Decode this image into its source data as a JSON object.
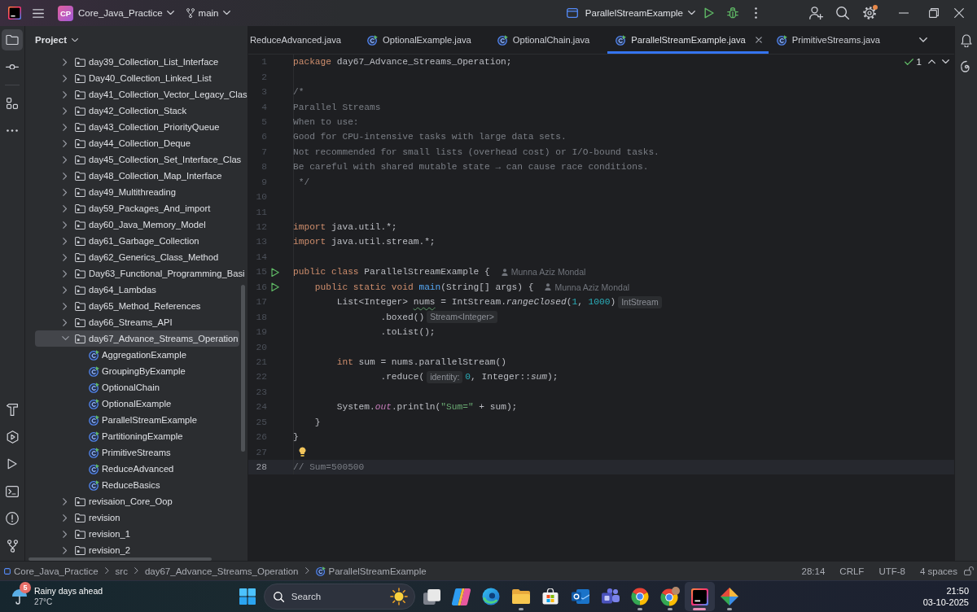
{
  "title_bar": {
    "project_badge": "CP",
    "project": "Core_Java_Practice",
    "branch": "main",
    "run_configuration": "ParallelStreamExample",
    "settings_notice": true
  },
  "tool_strip": {
    "top": [
      {
        "kind": "project",
        "selected": true
      },
      {
        "kind": "commit",
        "selected": false
      },
      {
        "kind": "structure",
        "selected": false
      },
      {
        "kind": "more",
        "selected": false
      }
    ],
    "bottom": [
      {
        "kind": "build",
        "selected": false
      },
      {
        "kind": "services",
        "selected": false
      },
      {
        "kind": "run",
        "selected": false
      },
      {
        "kind": "terminal",
        "selected": false
      },
      {
        "kind": "problems",
        "selected": false
      },
      {
        "kind": "git",
        "selected": false
      }
    ]
  },
  "project_panel": {
    "title": "Project",
    "items": [
      {
        "kind": "package",
        "label": "day39_Collection_List_Interface",
        "expanded": false,
        "selected": false
      },
      {
        "kind": "package",
        "label": "Day40_Collection_Linked_List",
        "expanded": false,
        "selected": false
      },
      {
        "kind": "package",
        "label": "day41_Collection_Vector_Legacy_Clas",
        "expanded": false,
        "selected": false
      },
      {
        "kind": "package",
        "label": "day42_Collection_Stack",
        "expanded": false,
        "selected": false
      },
      {
        "kind": "package",
        "label": "day43_Collection_PriorityQueue",
        "expanded": false,
        "selected": false
      },
      {
        "kind": "package",
        "label": "day44_Collection_Deque",
        "expanded": false,
        "selected": false
      },
      {
        "kind": "package",
        "label": "day45_Collection_Set_Interface_Clas",
        "expanded": false,
        "selected": false
      },
      {
        "kind": "package",
        "label": "day48_Collection_Map_Interface",
        "expanded": false,
        "selected": false
      },
      {
        "kind": "package",
        "label": "day49_Multithreading",
        "expanded": false,
        "selected": false
      },
      {
        "kind": "package",
        "label": "day59_Packages_And_import",
        "expanded": false,
        "selected": false
      },
      {
        "kind": "package",
        "label": "day60_Java_Memory_Model",
        "expanded": false,
        "selected": false
      },
      {
        "kind": "package",
        "label": "day61_Garbage_Collection",
        "expanded": false,
        "selected": false
      },
      {
        "kind": "package",
        "label": "day62_Generics_Class_Method",
        "expanded": false,
        "selected": false
      },
      {
        "kind": "package",
        "label": "Day63_Functional_Programming_Basi",
        "expanded": false,
        "selected": false
      },
      {
        "kind": "package",
        "label": "day64_Lambdas",
        "expanded": false,
        "selected": false
      },
      {
        "kind": "package",
        "label": "day65_Method_References",
        "expanded": false,
        "selected": false
      },
      {
        "kind": "package",
        "label": "day66_Streams_API",
        "expanded": false,
        "selected": false
      },
      {
        "kind": "package",
        "label": "day67_Advance_Streams_Operation",
        "expanded": true,
        "selected": true,
        "children": [
          {
            "kind": "class",
            "label": "AggregationExample",
            "selected": false
          },
          {
            "kind": "class",
            "label": "GroupingByExample",
            "selected": false
          },
          {
            "kind": "class",
            "label": "OptionalChain",
            "selected": false
          },
          {
            "kind": "class",
            "label": "OptionalExample",
            "selected": false
          },
          {
            "kind": "class",
            "label": "ParallelStreamExample",
            "selected": false
          },
          {
            "kind": "class",
            "label": "PartitioningExample",
            "selected": false
          },
          {
            "kind": "class",
            "label": "PrimitiveStreams",
            "selected": false
          },
          {
            "kind": "class",
            "label": "ReduceAdvanced",
            "selected": false
          },
          {
            "kind": "class",
            "label": "ReduceBasics",
            "selected": false
          }
        ]
      },
      {
        "kind": "package",
        "label": "revisaion_Core_Oop",
        "expanded": false,
        "selected": false
      },
      {
        "kind": "package",
        "label": "revision",
        "expanded": false,
        "selected": false
      },
      {
        "kind": "package",
        "label": "revision_1",
        "expanded": false,
        "selected": false
      },
      {
        "kind": "package",
        "label": "revision_2",
        "expanded": false,
        "selected": false
      }
    ]
  },
  "editor": {
    "tabs": [
      {
        "label": "ReduceAdvanced.java",
        "selected": false,
        "show_icon": false
      },
      {
        "label": "OptionalExample.java",
        "selected": false,
        "show_icon": true
      },
      {
        "label": "OptionalChain.java",
        "selected": false,
        "show_icon": true
      },
      {
        "label": "ParallelStreamExample.java",
        "selected": true,
        "show_icon": true
      },
      {
        "label": "PrimitiveStreams.java",
        "selected": false,
        "show_icon": true
      }
    ],
    "inspections": "1",
    "lines": [
      {
        "number": "1",
        "kind": "code",
        "current": false,
        "tokens": [
          {
            "kind": "keyword",
            "text": "package"
          },
          {
            "kind": "plain",
            "text": " day67_Advance_Streams_Operation;"
          }
        ]
      },
      {
        "number": "2",
        "kind": "code",
        "current": false
      },
      {
        "number": "3",
        "kind": "code",
        "current": false,
        "tokens": [
          {
            "kind": "comment",
            "text": "/*"
          }
        ]
      },
      {
        "number": "4",
        "kind": "code",
        "current": false,
        "tokens": [
          {
            "kind": "comment",
            "text": "Parallel Streams"
          }
        ]
      },
      {
        "number": "5",
        "kind": "code",
        "current": false,
        "tokens": [
          {
            "kind": "comment",
            "text": "When to use:"
          }
        ]
      },
      {
        "number": "6",
        "kind": "code",
        "current": false,
        "tokens": [
          {
            "kind": "comment",
            "text": "Good for CPU-intensive tasks with large data sets."
          }
        ]
      },
      {
        "number": "7",
        "kind": "code",
        "current": false,
        "tokens": [
          {
            "kind": "comment",
            "text": "Not recommended for small lists (overhead cost) or I/O-bound tasks."
          }
        ]
      },
      {
        "number": "8",
        "kind": "code",
        "current": false,
        "tokens": [
          {
            "kind": "comment",
            "text": "Be careful with shared mutable state → can cause race conditions."
          }
        ]
      },
      {
        "number": "9",
        "kind": "code",
        "current": false,
        "tokens": [
          {
            "kind": "comment",
            "text": " */"
          }
        ]
      },
      {
        "number": "10",
        "kind": "code",
        "current": false
      },
      {
        "number": "11",
        "kind": "code",
        "current": false
      },
      {
        "number": "12",
        "kind": "code",
        "current": false,
        "tokens": [
          {
            "kind": "keyword",
            "text": "import"
          },
          {
            "kind": "plain",
            "text": " java.util.*;"
          }
        ]
      },
      {
        "number": "13",
        "kind": "code",
        "current": false,
        "tokens": [
          {
            "kind": "keyword",
            "text": "import"
          },
          {
            "kind": "plain",
            "text": " java.util.stream.*;"
          }
        ]
      },
      {
        "number": "14",
        "kind": "code",
        "current": false
      },
      {
        "number": "15",
        "kind": "runnable",
        "current": false,
        "tokens": [
          {
            "kind": "keyword",
            "text": "public class"
          },
          {
            "kind": "plain",
            "text": " ParallelStreamExample {"
          },
          {
            "kind": "author",
            "text": "Munna Aziz Mondal"
          }
        ]
      },
      {
        "number": "16",
        "kind": "runnable",
        "current": false,
        "tokens": [
          {
            "kind": "keyword",
            "text": "    public static void "
          },
          {
            "kind": "method",
            "text": "main"
          },
          {
            "kind": "plain",
            "text": "(String[] args) {"
          },
          {
            "kind": "author",
            "text": "Munna Aziz Mondal"
          }
        ]
      },
      {
        "number": "17",
        "kind": "code",
        "current": false,
        "tokens": [
          {
            "kind": "plain",
            "text": "        List<Integer> "
          },
          {
            "kind": "typo",
            "text": "nums"
          },
          {
            "kind": "plain",
            "text": " = IntStream."
          },
          {
            "kind": "static-call",
            "text": "rangeClosed"
          },
          {
            "kind": "plain",
            "text": "("
          },
          {
            "kind": "number",
            "text": "1"
          },
          {
            "kind": "plain",
            "text": ", "
          },
          {
            "kind": "number",
            "text": "1000"
          },
          {
            "kind": "plain",
            "text": ")"
          },
          {
            "kind": "hint",
            "text": "IntStream"
          }
        ]
      },
      {
        "number": "18",
        "kind": "code",
        "current": false,
        "tokens": [
          {
            "kind": "plain",
            "text": "                .boxed()"
          },
          {
            "kind": "hint",
            "text": "Stream<Integer>"
          }
        ]
      },
      {
        "number": "19",
        "kind": "code",
        "current": false,
        "tokens": [
          {
            "kind": "plain",
            "text": "                .toList();"
          }
        ]
      },
      {
        "number": "20",
        "kind": "code",
        "current": false
      },
      {
        "number": "21",
        "kind": "code",
        "current": false,
        "tokens": [
          {
            "kind": "keyword",
            "text": "        int"
          },
          {
            "kind": "plain",
            "text": " sum = nums.parallelStream()"
          }
        ]
      },
      {
        "number": "22",
        "kind": "code",
        "current": false,
        "tokens": [
          {
            "kind": "plain",
            "text": "                .reduce("
          },
          {
            "kind": "hint",
            "text": "identity:"
          },
          {
            "kind": "number",
            "text": "0"
          },
          {
            "kind": "plain",
            "text": ", Integer::"
          },
          {
            "kind": "static-call",
            "text": "sum"
          },
          {
            "kind": "plain",
            "text": ");"
          }
        ]
      },
      {
        "number": "23",
        "kind": "code",
        "current": false
      },
      {
        "number": "24",
        "kind": "code",
        "current": false,
        "tokens": [
          {
            "kind": "plain",
            "text": "        System."
          },
          {
            "kind": "static-field",
            "text": "out"
          },
          {
            "kind": "plain",
            "text": ".println("
          },
          {
            "kind": "string",
            "text": "\"Sum=\""
          },
          {
            "kind": "plain",
            "text": " + sum);"
          }
        ]
      },
      {
        "number": "25",
        "kind": "code",
        "current": false,
        "tokens": [
          {
            "kind": "plain",
            "text": "    }"
          }
        ]
      },
      {
        "number": "26",
        "kind": "code",
        "current": false,
        "tokens": [
          {
            "kind": "plain",
            "text": "}"
          }
        ]
      },
      {
        "number": "27",
        "kind": "suggestion",
        "current": false
      },
      {
        "number": "28",
        "kind": "code",
        "current": true,
        "tokens": [
          {
            "kind": "comment",
            "text": "// Sum=500500"
          }
        ]
      }
    ]
  },
  "right_strip": [
    {
      "kind": "notifications"
    },
    {
      "kind": "assistant"
    }
  ],
  "status_bar": {
    "breadcrumbs": [
      {
        "kind": "module",
        "label": "Core_Java_Practice"
      },
      {
        "kind": "directory",
        "label": "src"
      },
      {
        "kind": "directory",
        "label": "day67_Advance_Streams_Operation"
      },
      {
        "kind": "class",
        "label": "ParallelStreamExample"
      }
    ],
    "caret_position": "28:14",
    "line_separator": "CRLF",
    "encoding": "UTF-8",
    "indentation": "4 spaces"
  },
  "taskbar": {
    "weather": {
      "alerts": "5",
      "summary": "Rainy days ahead",
      "temperature": "27°C"
    },
    "search": {
      "placeholder": "Search"
    },
    "apps": [
      {
        "kind": "task-view",
        "running": false,
        "selected": false
      },
      {
        "kind": "ribbon",
        "running": false,
        "selected": false
      },
      {
        "kind": "browser",
        "running": false,
        "selected": false
      },
      {
        "kind": "files",
        "running": true,
        "selected": false
      },
      {
        "kind": "store",
        "running": false,
        "selected": false
      },
      {
        "kind": "mail",
        "running": false,
        "selected": false
      },
      {
        "kind": "chat",
        "running": false,
        "selected": false
      },
      {
        "kind": "wheel",
        "running": true,
        "selected": false
      },
      {
        "kind": "wheel-avatar",
        "running": true,
        "selected": false
      },
      {
        "kind": "ide",
        "running": true,
        "selected": true
      },
      {
        "kind": "diamond",
        "running": true,
        "selected": false
      }
    ],
    "clock": {
      "time": "21:50",
      "date": "03-10-2025"
    }
  }
}
